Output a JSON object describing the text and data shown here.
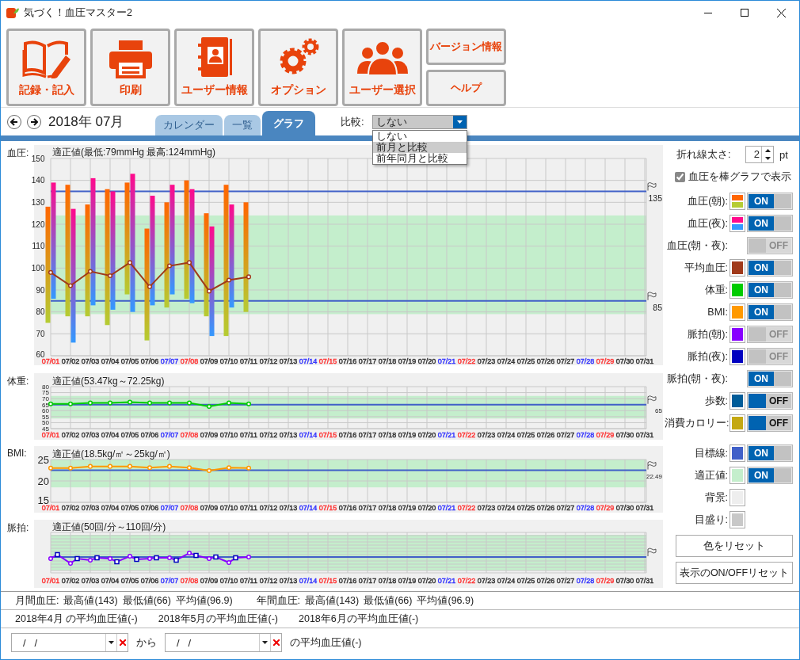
{
  "window": {
    "title": "気づく！血圧マスター2"
  },
  "toolbar": {
    "buttons": [
      {
        "label": "記録・記入",
        "kind": "book"
      },
      {
        "label": "印刷",
        "kind": "printer"
      },
      {
        "label": "ユーザー情報",
        "kind": "contacts"
      },
      {
        "label": "オプション",
        "kind": "gears"
      },
      {
        "label": "ユーザー選択",
        "kind": "people"
      }
    ],
    "side_buttons": [
      "バージョン情報",
      "ヘルプ"
    ]
  },
  "nav": {
    "month": "2018年 07月",
    "tabs": [
      {
        "label": "カレンダー",
        "selected": false
      },
      {
        "label": "一覧",
        "selected": false
      },
      {
        "label": "グラフ",
        "selected": true
      }
    ],
    "compare": {
      "label": "比較:",
      "value": "しない",
      "expanded": true,
      "options": [
        {
          "label": "しない",
          "highlighted": false
        },
        {
          "label": "前月と比較",
          "highlighted": true
        },
        {
          "label": "前年同月と比較",
          "highlighted": false
        }
      ]
    }
  },
  "charts": [
    {
      "label": "血圧:",
      "title": "適正値(最低:79mmHg 最高:124mmHg)",
      "date_label_colors": [
        {
          "color": "#ff3333"
        },
        {
          "color": "#333333"
        },
        {
          "color": "#333333"
        },
        {
          "color": "#333333"
        },
        {
          "color": "#333333"
        },
        {
          "color": "#333333"
        },
        {
          "color": "#3333ff"
        },
        {
          "color": "#ff3333"
        },
        {
          "color": "#333333"
        },
        {
          "color": "#333333"
        },
        {
          "color": "#333333"
        },
        {
          "color": "#333333"
        },
        {
          "color": "#333333"
        },
        {
          "color": "#3333ff"
        },
        {
          "color": "#ff3333"
        },
        {
          "color": "#333333"
        },
        {
          "color": "#333333"
        },
        {
          "color": "#333333"
        },
        {
          "color": "#333333"
        },
        {
          "color": "#333333"
        },
        {
          "color": "#3333ff"
        },
        {
          "color": "#ff3333"
        },
        {
          "color": "#333333"
        },
        {
          "color": "#333333"
        },
        {
          "color": "#333333"
        },
        {
          "color": "#333333"
        },
        {
          "color": "#333333"
        },
        {
          "color": "#3333ff"
        },
        {
          "color": "#ff3333"
        },
        {
          "color": "#333333"
        },
        {
          "color": "#333333"
        }
      ],
      "chart_data": {
        "type": "bar",
        "grid": true,
        "categories": [
          "07/01",
          "07/02",
          "07/03",
          "07/04",
          "07/05",
          "07/06",
          "07/07",
          "07/08",
          "07/09",
          "07/10",
          "07/11",
          "07/12",
          "07/13",
          "07/14",
          "07/15",
          "07/16",
          "07/17",
          "07/18",
          "07/19",
          "07/20",
          "07/21",
          "07/22",
          "07/23",
          "07/24",
          "07/25",
          "07/26",
          "07/27",
          "07/28",
          "07/29",
          "07/30",
          "07/31"
        ],
        "ylim": [
          60,
          150
        ],
        "yticks": [
          60,
          70,
          80,
          90,
          100,
          110,
          120,
          130,
          140,
          150
        ],
        "series": [
          {
            "color": "#ff6600",
            "values": [
              53,
              60,
              51,
              62,
              51,
              51,
              48,
              54,
              47,
              69,
              50,
              null,
              null,
              null,
              null,
              null,
              null,
              null,
              null,
              null,
              null,
              null,
              null,
              null,
              null,
              null,
              null,
              null,
              null,
              null,
              null
            ],
            "base": [
              75,
              78,
              78,
              74,
              88,
              67,
              82,
              86,
              78,
              69,
              80,
              null,
              null,
              null,
              null,
              null,
              null,
              null,
              null,
              null,
              null,
              null,
              null,
              null,
              null,
              null,
              null,
              null,
              null,
              null,
              null
            ]
          },
          {
            "color": "#ff0a8c",
            "values": [
              53,
              61,
              58,
              54,
              63,
              50,
              50,
              52,
              50,
              47,
              null,
              null,
              null,
              null,
              null,
              null,
              null,
              null,
              null,
              null,
              null,
              null,
              null,
              null,
              null,
              null,
              null,
              null,
              null,
              null,
              null
            ],
            "base": [
              86,
              66,
              83,
              81,
              80,
              83,
              88,
              84,
              69,
              82,
              null,
              null,
              null,
              null,
              null,
              null,
              null,
              null,
              null,
              null,
              null,
              null,
              null,
              null,
              null,
              null,
              null,
              null,
              null,
              null,
              null
            ]
          },
          {
            "type": "line",
            "color": "#a0391a",
            "marker": "o",
            "values": [
              98,
              92,
              98.5,
              96.5,
              102.5,
              91.5,
              101,
              102.5,
              89.5,
              94.5,
              96,
              null,
              null,
              null,
              null,
              null,
              null,
              null,
              null,
              null,
              null,
              null,
              null,
              null,
              null,
              null,
              null,
              null,
              null,
              null,
              null
            ]
          }
        ],
        "bands": [
          {
            "axis": "y",
            "from": 79,
            "to": 124,
            "color": "#c4eecc"
          }
        ],
        "ref_lines": [
          {
            "axis": "y",
            "value": 135,
            "label": "135",
            "color": "#4060c8"
          },
          {
            "axis": "y",
            "value": 85,
            "label": "85",
            "color": "#4060c8"
          }
        ]
      }
    },
    {
      "label": "体重:",
      "title": "適正値(53.47kg～72.25kg)",
      "date_label_colors": [
        {
          "color": "#ff3333"
        },
        {
          "color": "#333333"
        },
        {
          "color": "#333333"
        },
        {
          "color": "#333333"
        },
        {
          "color": "#333333"
        },
        {
          "color": "#333333"
        },
        {
          "color": "#3333ff"
        },
        {
          "color": "#ff3333"
        },
        {
          "color": "#333333"
        },
        {
          "color": "#333333"
        },
        {
          "color": "#333333"
        },
        {
          "color": "#333333"
        },
        {
          "color": "#333333"
        },
        {
          "color": "#3333ff"
        },
        {
          "color": "#ff3333"
        },
        {
          "color": "#333333"
        },
        {
          "color": "#333333"
        },
        {
          "color": "#333333"
        },
        {
          "color": "#333333"
        },
        {
          "color": "#333333"
        },
        {
          "color": "#3333ff"
        },
        {
          "color": "#ff3333"
        },
        {
          "color": "#333333"
        },
        {
          "color": "#333333"
        },
        {
          "color": "#333333"
        },
        {
          "color": "#333333"
        },
        {
          "color": "#333333"
        },
        {
          "color": "#3333ff"
        },
        {
          "color": "#ff3333"
        },
        {
          "color": "#333333"
        },
        {
          "color": "#333333"
        }
      ],
      "chart_data": {
        "type": "line",
        "grid": true,
        "categories": [
          "07/01",
          "07/02",
          "07/03",
          "07/04",
          "07/05",
          "07/06",
          "07/07",
          "07/08",
          "07/09",
          "07/10",
          "07/11",
          "07/12",
          "07/13",
          "07/14",
          "07/15",
          "07/16",
          "07/17",
          "07/18",
          "07/19",
          "07/20",
          "07/21",
          "07/22",
          "07/23",
          "07/24",
          "07/25",
          "07/26",
          "07/27",
          "07/28",
          "07/29",
          "07/30",
          "07/31"
        ],
        "ylim": [
          45,
          80
        ],
        "yticks": [
          45,
          50,
          55,
          60,
          65,
          70,
          75,
          80
        ],
        "series": [
          {
            "color": "#00cc00",
            "marker": "o",
            "values": [
              65.6,
              65.6,
              66.4,
              66.4,
              67.1,
              66.4,
              66.4,
              66.4,
              63.5,
              66.4,
              65.6,
              null,
              null,
              null,
              null,
              null,
              null,
              null,
              null,
              null,
              null,
              null,
              null,
              null,
              null,
              null,
              null,
              null,
              null,
              null,
              null
            ]
          }
        ],
        "bands": [
          {
            "axis": "y",
            "from": 53.47,
            "to": 72.25,
            "color": "#c4eecc"
          }
        ],
        "ref_lines": [
          {
            "axis": "y",
            "value": 65,
            "label": "65",
            "color": "#4060c8"
          }
        ]
      }
    },
    {
      "label": "BMI:",
      "title": "適正値(18.5kg/㎡～25kg/㎡)",
      "date_label_colors": [
        {
          "color": "#ff3333"
        },
        {
          "color": "#333333"
        },
        {
          "color": "#333333"
        },
        {
          "color": "#333333"
        },
        {
          "color": "#333333"
        },
        {
          "color": "#333333"
        },
        {
          "color": "#3333ff"
        },
        {
          "color": "#ff3333"
        },
        {
          "color": "#333333"
        },
        {
          "color": "#333333"
        },
        {
          "color": "#333333"
        },
        {
          "color": "#333333"
        },
        {
          "color": "#333333"
        },
        {
          "color": "#3333ff"
        },
        {
          "color": "#ff3333"
        },
        {
          "color": "#333333"
        },
        {
          "color": "#333333"
        },
        {
          "color": "#333333"
        },
        {
          "color": "#333333"
        },
        {
          "color": "#333333"
        },
        {
          "color": "#3333ff"
        },
        {
          "color": "#ff3333"
        },
        {
          "color": "#333333"
        },
        {
          "color": "#333333"
        },
        {
          "color": "#333333"
        },
        {
          "color": "#333333"
        },
        {
          "color": "#333333"
        },
        {
          "color": "#3333ff"
        },
        {
          "color": "#ff3333"
        },
        {
          "color": "#333333"
        },
        {
          "color": "#333333"
        }
      ],
      "chart_data": {
        "type": "line",
        "grid": true,
        "categories": [
          "07/01",
          "07/02",
          "07/03",
          "07/04",
          "07/05",
          "07/06",
          "07/07",
          "07/08",
          "07/09",
          "07/10",
          "07/11",
          "07/12",
          "07/13",
          "07/14",
          "07/15",
          "07/16",
          "07/17",
          "07/18",
          "07/19",
          "07/20",
          "07/21",
          "07/22",
          "07/23",
          "07/24",
          "07/25",
          "07/26",
          "07/27",
          "07/28",
          "07/29",
          "07/30",
          "07/31"
        ],
        "ylim": [
          15,
          25
        ],
        "yticks": [
          15,
          20,
          25
        ],
        "series": [
          {
            "color": "#ff9900",
            "marker": "o",
            "values": [
              23,
              23,
              23.4,
              23.4,
              23.4,
              23.1,
              23.4,
              23.1,
              22.4,
              23.1,
              23,
              null,
              null,
              null,
              null,
              null,
              null,
              null,
              null,
              null,
              null,
              null,
              null,
              null,
              null,
              null,
              null,
              null,
              null,
              null,
              null
            ]
          }
        ],
        "bands": [
          {
            "axis": "y",
            "from": 18.5,
            "to": 25,
            "color": "#c4eecc"
          }
        ],
        "ref_lines": [
          {
            "axis": "y",
            "value": 22.49,
            "label": "22.49",
            "color": "#4060c8"
          }
        ]
      }
    },
    {
      "label": "脈拍:",
      "title": "適正値(50回/分～110回/分)",
      "x_labels": [
        {
          "label": "07/01",
          "color": "#ff3333"
        },
        {
          "label": "07/02",
          "color": "#333333"
        },
        {
          "label": "07/03",
          "color": "#333333"
        },
        {
          "label": "07/04",
          "color": "#333333"
        },
        {
          "label": "07/05",
          "color": "#333333"
        },
        {
          "label": "07/06",
          "color": "#333333"
        },
        {
          "label": "07/07",
          "color": "#3333ff"
        },
        {
          "label": "07/08",
          "color": "#ff3333"
        },
        {
          "label": "07/09",
          "color": "#333333"
        },
        {
          "label": "07/10",
          "color": "#333333"
        },
        {
          "label": "07/11",
          "color": "#333333"
        },
        {
          "label": "07/12",
          "color": "#333333"
        },
        {
          "label": "07/13",
          "color": "#333333"
        },
        {
          "label": "07/14",
          "color": "#3333ff"
        },
        {
          "label": "07/15",
          "color": "#ff3333"
        },
        {
          "label": "07/16",
          "color": "#333333"
        },
        {
          "label": "07/17",
          "color": "#333333"
        },
        {
          "label": "07/18",
          "color": "#333333"
        },
        {
          "label": "07/19",
          "color": "#333333"
        },
        {
          "label": "07/20",
          "color": "#333333"
        },
        {
          "label": "07/21",
          "color": "#3333ff"
        },
        {
          "label": "07/22",
          "color": "#ff3333"
        },
        {
          "label": "07/23",
          "color": "#333333"
        },
        {
          "label": "07/24",
          "color": "#333333"
        },
        {
          "label": "07/25",
          "color": "#333333"
        },
        {
          "label": "07/26",
          "color": "#333333"
        },
        {
          "label": "07/27",
          "color": "#333333"
        },
        {
          "label": "07/28",
          "color": "#3333ff"
        },
        {
          "label": "07/29",
          "color": "#ff3333"
        },
        {
          "label": "07/30",
          "color": "#333333"
        },
        {
          "label": "07/31",
          "color": "#333333"
        }
      ]
    }
  ],
  "panel": {
    "line_width": {
      "label": "折れ線太さ:",
      "value": "2",
      "unit": "pt"
    },
    "bar_graph": {
      "label": "血圧を棒グラフで表示",
      "checked": true
    },
    "display_rows": [
      {
        "kind": "swatch_toggle",
        "label": "血圧(朝):",
        "colors": [
          {
            "color": "#ff6600"
          },
          {
            "color": "#b5cc33"
          }
        ],
        "on": true,
        "emphasized": false,
        "toggle_text": "ON"
      },
      {
        "kind": "swatch_toggle",
        "label": "血圧(夜):",
        "colors": [
          {
            "color": "#ff0a8c"
          },
          {
            "color": "#3399ff"
          }
        ],
        "on": true,
        "emphasized": false,
        "toggle_text": "ON"
      },
      {
        "kind": "toggle",
        "label": "血圧(朝・夜):",
        "on": false,
        "emphasized": false,
        "toggle_text": "OFF"
      },
      {
        "kind": "swatch_toggle",
        "label": "平均血圧:",
        "colors": [
          {
            "color": "#a0391a"
          }
        ],
        "on": true,
        "emphasized": false,
        "toggle_text": "ON"
      },
      {
        "kind": "swatch_toggle",
        "label": "体重:",
        "colors": [
          {
            "color": "#00cc00"
          }
        ],
        "on": true,
        "emphasized": false,
        "toggle_text": "ON"
      },
      {
        "kind": "swatch_toggle",
        "label": "BMI:",
        "colors": [
          {
            "color": "#ff9900"
          }
        ],
        "on": true,
        "emphasized": false,
        "toggle_text": "ON"
      },
      {
        "kind": "swatch_toggle",
        "label": "脈拍(朝):",
        "colors": [
          {
            "color": "#8800ff"
          }
        ],
        "on": false,
        "emphasized": false,
        "toggle_text": "OFF"
      },
      {
        "kind": "swatch_toggle",
        "label": "脈拍(夜):",
        "colors": [
          {
            "color": "#0000c0"
          }
        ],
        "on": false,
        "emphasized": false,
        "toggle_text": "OFF"
      },
      {
        "kind": "toggle",
        "label": "脈拍(朝・夜):",
        "on": true,
        "emphasized": false,
        "toggle_text": "ON"
      },
      {
        "kind": "swatch_toggle",
        "label": "歩数:",
        "colors": [
          {
            "color": "#005c99"
          }
        ],
        "on": false,
        "emphasized": true,
        "toggle_text": "OFF"
      },
      {
        "kind": "swatch_toggle",
        "label": "消費カロリー:",
        "colors": [
          {
            "color": "#c4a812"
          }
        ],
        "on": false,
        "emphasized": true,
        "toggle_text": "OFF"
      }
    ],
    "style_rows": [
      {
        "kind": "swatch_toggle",
        "label": "目標線:",
        "colors": [
          {
            "color": "#4060c8"
          }
        ],
        "on": true,
        "emphasized": false,
        "toggle_text": "ON"
      },
      {
        "kind": "swatch_toggle",
        "label": "適正値:",
        "colors": [
          {
            "color": "#c4eecc"
          }
        ],
        "on": true,
        "emphasized": false,
        "toggle_text": "ON"
      },
      {
        "kind": "swatch",
        "label": "背景:",
        "colors": [
          {
            "color": "#eeeeee"
          }
        ]
      },
      {
        "kind": "swatch",
        "label": "目盛り:",
        "colors": [
          {
            "color": "#c8c8c8"
          }
        ]
      }
    ],
    "buttons": [
      "色をリセット",
      "表示のON/OFFリセット"
    ]
  },
  "summary": {
    "monthly": {
      "label": "月間血圧:",
      "stats": [
        "最高値(143)",
        "最低値(66)",
        "平均値(96.9)"
      ]
    },
    "yearly": {
      "label": "年間血圧:",
      "stats": [
        "最高値(143)",
        "最低値(66)",
        "平均値(96.9)"
      ]
    },
    "previous": [
      "2018年4月 の平均血圧値(-)",
      "2018年5月の平均血圧値(-)",
      "2018年6月の平均血圧値(-)"
    ],
    "range": {
      "from": "/   /",
      "joiner": "から",
      "to": "/   /",
      "result": "の平均血圧値(-)"
    }
  }
}
